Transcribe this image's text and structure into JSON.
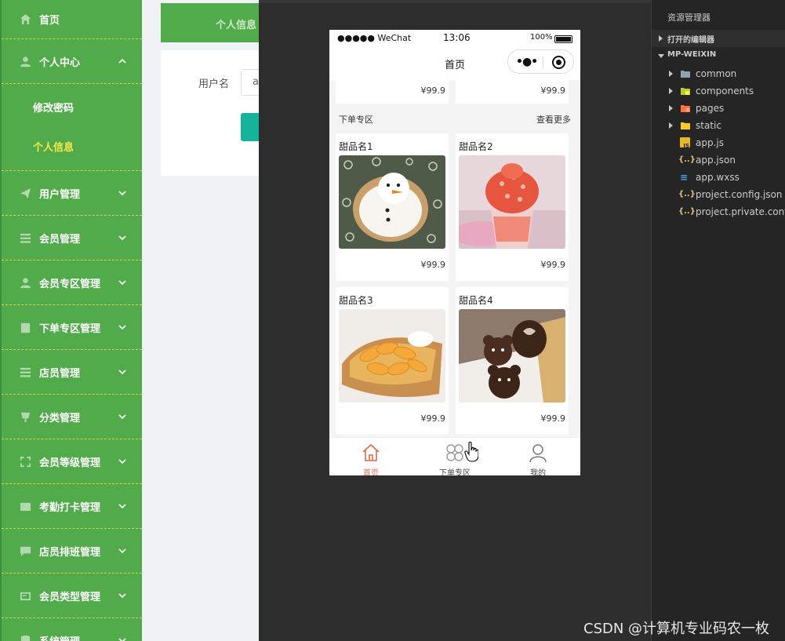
{
  "admin": {
    "sidebar": {
      "items": [
        {
          "label": "首页",
          "icon": "home-icon"
        },
        {
          "label": "个人中心",
          "icon": "user-icon",
          "expanded": true,
          "children": [
            {
              "label": "修改密码",
              "active": false
            },
            {
              "label": "个人信息",
              "active": true
            }
          ]
        },
        {
          "label": "用户管理",
          "icon": "send-icon"
        },
        {
          "label": "会员管理",
          "icon": "list-icon"
        },
        {
          "label": "会员专区管理",
          "icon": "user-icon"
        },
        {
          "label": "下单专区管理",
          "icon": "clipboard-icon"
        },
        {
          "label": "店员管理",
          "icon": "list-icon"
        },
        {
          "label": "分类管理",
          "icon": "cup-icon"
        },
        {
          "label": "会员等级管理",
          "icon": "expand-icon"
        },
        {
          "label": "考勤打卡管理",
          "icon": "card-icon"
        },
        {
          "label": "店员排班管理",
          "icon": "chat-icon"
        },
        {
          "label": "会员类型管理",
          "icon": "id-card-icon"
        },
        {
          "label": "系统管理",
          "icon": "database-icon"
        }
      ]
    },
    "content": {
      "tab_label": "个人信息",
      "form_label": "用户名",
      "input_value": "a"
    }
  },
  "phone": {
    "status": {
      "signal": "●●●●● WeChat",
      "time": "13:06",
      "battery": "100%"
    },
    "nav_title": "首页",
    "top_prices": [
      "¥99.9",
      "¥99.9"
    ],
    "section": {
      "title": "下单专区",
      "more": "查看更多"
    },
    "products": [
      {
        "name": "甜品名1",
        "price": "¥99.9",
        "image": "snowman-cookie"
      },
      {
        "name": "甜品名2",
        "price": "¥99.9",
        "image": "strawberry-parfait"
      },
      {
        "name": "甜品名3",
        "price": "¥99.9",
        "image": "peach-tart"
      },
      {
        "name": "甜品名4",
        "price": "¥99.9",
        "image": "chocolate-bear-cake"
      }
    ],
    "tabbar": [
      {
        "label": "首页",
        "active": true,
        "icon": "home-icon"
      },
      {
        "label": "下单专区",
        "active": false,
        "icon": "grid-icon"
      },
      {
        "label": "我的",
        "active": false,
        "icon": "person-icon"
      }
    ]
  },
  "explorer": {
    "title": "资源管理器",
    "open_editors": "打开的编辑器",
    "project": "MP-WEIXIN",
    "folders": [
      "common",
      "components",
      "pages",
      "static"
    ],
    "files": [
      "app.js",
      "app.json",
      "app.wxss",
      "project.config.json",
      "project.private.config.json"
    ]
  },
  "watermark": "CSDN @计算机专业码农一枚",
  "colors": {
    "sidebar": "#52ab4b",
    "accent_yellow": "#f5e94a",
    "button": "#16b29a",
    "tab_active": "#e06a48"
  }
}
